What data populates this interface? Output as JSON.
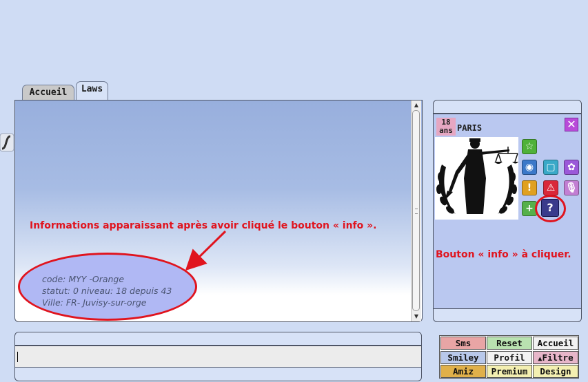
{
  "tabs": [
    {
      "label": "Accueil"
    },
    {
      "label": "Laws"
    }
  ],
  "annotations": {
    "info_caption": "Informations apparaissant après avoir cliqué le bouton « info ».",
    "button_caption": "Bouton « info » à cliquer.",
    "color": "#e0141e"
  },
  "info": {
    "code": "code: MYY -Orange",
    "statut": "statut: 0 niveau: 18 depuis 43",
    "ville": "Ville: FR- Juvisy-sur-orge"
  },
  "message_input": {
    "value": ""
  },
  "profile": {
    "age_number": "18",
    "age_unit": "ans",
    "city": "PARIS",
    "close_icon": "close-icon",
    "avatar": "lady-justice-laurel-image",
    "actions": [
      {
        "icon": "star-icon",
        "color": "#4fb13a"
      },
      {
        "icon": "webcam-icon",
        "color": "#3b78c9"
      },
      {
        "icon": "photo-frame-icon",
        "color": "#39a9c8"
      },
      {
        "icon": "flower-icon",
        "color": "#9b59d9"
      },
      {
        "icon": "warning-circle-icon",
        "color": "#e0a020"
      },
      {
        "icon": "alert-triangle-icon",
        "color": "#d9283a"
      },
      {
        "icon": "microphone-icon",
        "color": "#c27ed3"
      },
      {
        "icon": "plus-icon",
        "color": "#55b04a"
      },
      {
        "icon": "question-mark-icon",
        "color": "#3a3b8c",
        "label": "?"
      }
    ]
  },
  "buttons": [
    {
      "label": "Sms",
      "color": "#e8a5a5"
    },
    {
      "label": "Reset",
      "color": "#b9e2b0"
    },
    {
      "label": "Accueil",
      "color": "#f2f2f2"
    },
    {
      "label": "Smiley",
      "color": "#b8c8ea"
    },
    {
      "label": "Profil",
      "color": "#f2f2f2"
    },
    {
      "label": "Filtre",
      "color": "#e7b6c9",
      "icon": "up-arrow-icon"
    },
    {
      "label": "Amiz",
      "color": "#e0b04a"
    },
    {
      "label": "Premium",
      "color": "#f3efb1"
    },
    {
      "label": "Design",
      "color": "#f3efb1"
    }
  ]
}
